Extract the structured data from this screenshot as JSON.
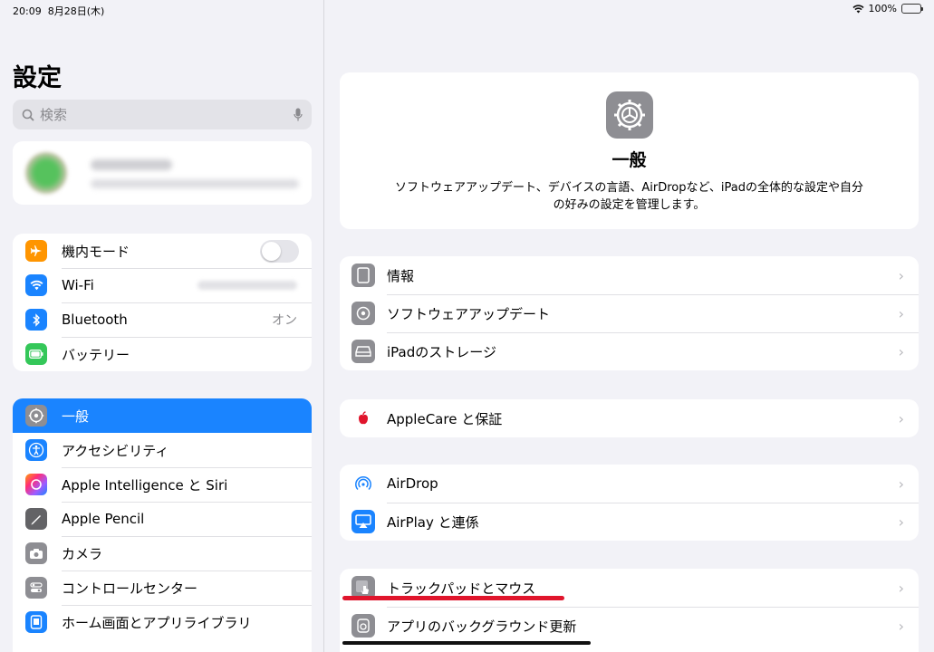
{
  "status_bar": {
    "time": "20:09",
    "date": "8月28日(木)",
    "battery": "100%"
  },
  "sidebar": {
    "title": "設定",
    "search": {
      "placeholder": "検索"
    },
    "group1": [
      {
        "icon": "airplane-icon",
        "label": "機内モード",
        "color": "#ff9500"
      },
      {
        "icon": "wifi-icon",
        "label": "Wi-Fi",
        "color": "#1a84ff"
      },
      {
        "icon": "bluetooth-icon",
        "label": "Bluetooth",
        "value": "オン",
        "color": "#1a84ff"
      },
      {
        "icon": "battery-icon",
        "label": "バッテリー",
        "color": "#34c759"
      }
    ],
    "group2": [
      {
        "icon": "gear-icon",
        "label": "一般",
        "color": "#8e8e93",
        "selected": true
      },
      {
        "icon": "accessibility-icon",
        "label": "アクセシビリティ",
        "color": "#1a84ff"
      },
      {
        "icon": "siri-icon",
        "label": "Apple Intelligence と Siri",
        "color": "#a05cff"
      },
      {
        "icon": "pencil-icon",
        "label": "Apple Pencil",
        "color": "#636366"
      },
      {
        "icon": "camera-icon",
        "label": "カメラ",
        "color": "#8e8e93"
      },
      {
        "icon": "control-center-icon",
        "label": "コントロールセンター",
        "color": "#8e8e93"
      },
      {
        "icon": "home-screen-icon",
        "label": "ホーム画面とアプリライブラリ",
        "color": "#1a84ff"
      }
    ]
  },
  "detail": {
    "header": {
      "title": "一般",
      "description": "ソフトウェアアップデート、デバイスの言語、AirDropなど、iPadの全体的な設定や自分の好みの設定を管理します。"
    },
    "groups": [
      [
        {
          "icon": "ipad-icon",
          "label": "情報",
          "color": "#8e8e93"
        },
        {
          "icon": "software-update-icon",
          "label": "ソフトウェアアップデート",
          "color": "#8e8e93"
        },
        {
          "icon": "storage-icon",
          "label": "iPadのストレージ",
          "color": "#8e8e93"
        }
      ],
      [
        {
          "icon": "apple-icon",
          "label": "AppleCare と保証",
          "color": "#ffffff"
        }
      ],
      [
        {
          "icon": "airdrop-icon",
          "label": "AirDrop",
          "color": "#ffffff"
        },
        {
          "icon": "airplay-icon",
          "label": "AirPlay と連係",
          "color": "#1a84ff"
        }
      ],
      [
        {
          "icon": "trackpad-icon",
          "label": "トラックパッドとマウス",
          "color": "#8e8e93"
        },
        {
          "icon": "background-refresh-icon",
          "label": "アプリのバックグラウンド更新",
          "color": "#8e8e93"
        }
      ]
    ]
  }
}
